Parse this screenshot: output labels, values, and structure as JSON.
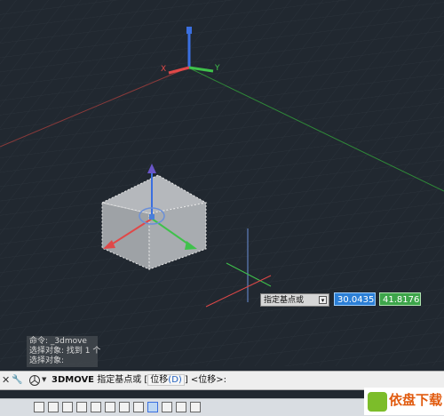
{
  "viewport": {
    "axes": {
      "x_label": "X",
      "y_label": "Y"
    },
    "colors": {
      "background": "#212830",
      "x_axis": "#e04848",
      "y_axis": "#3fc14b",
      "z_axis": "#3a6fe0"
    }
  },
  "dynamic_input": {
    "prompt": "指定基点或",
    "x_value": "30.0435",
    "y_value": "41.8176"
  },
  "command_history": [
    "命令: _3dmove",
    "选择对象: 找到 1 个",
    "选择对象:"
  ],
  "command_line": {
    "command": "3DMOVE",
    "prompt": "指定基点或",
    "option_open": "[",
    "option": "位移",
    "option_key": "(D)",
    "option_close": "]",
    "default": "<位移>:"
  },
  "watermark": {
    "text": "依盘下载"
  }
}
